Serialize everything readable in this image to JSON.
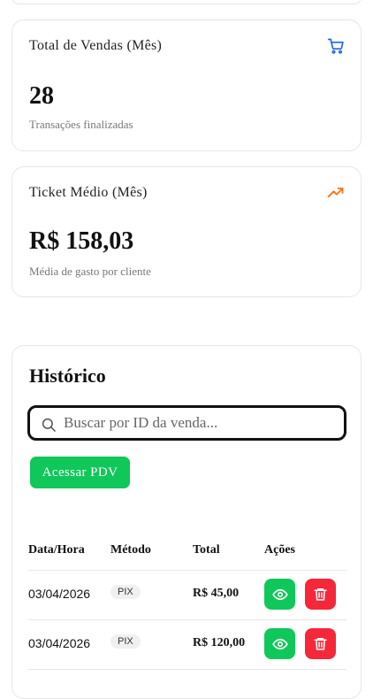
{
  "stats": {
    "vendas": {
      "title": "Total de Vendas (Mês)",
      "value": "28",
      "subtitle": "Transações finalizadas",
      "icon": "cart-icon",
      "icon_color": "#2563eb"
    },
    "ticket": {
      "title": "Ticket Médio (Mês)",
      "value": "R$ 158,03",
      "subtitle": "Média de gasto por cliente",
      "icon": "trending-up-icon",
      "icon_color": "#f97316"
    }
  },
  "history": {
    "title": "Histórico",
    "search_placeholder": "Buscar por ID da venda...",
    "pdv_label": "Acessar PDV",
    "columns": [
      "Data/Hora",
      "Método",
      "Total",
      "Ações"
    ],
    "rows": [
      {
        "date": "03/04/2026",
        "method": "PIX",
        "total": "R$ 45,00"
      },
      {
        "date": "03/04/2026",
        "method": "PIX",
        "total": "R$ 120,00"
      }
    ],
    "view_icon": "eye-icon",
    "delete_icon": "trash-icon"
  },
  "colors": {
    "primary_green": "#10c75a",
    "danger_red": "#f5283a",
    "border": "#e6e6e6"
  }
}
